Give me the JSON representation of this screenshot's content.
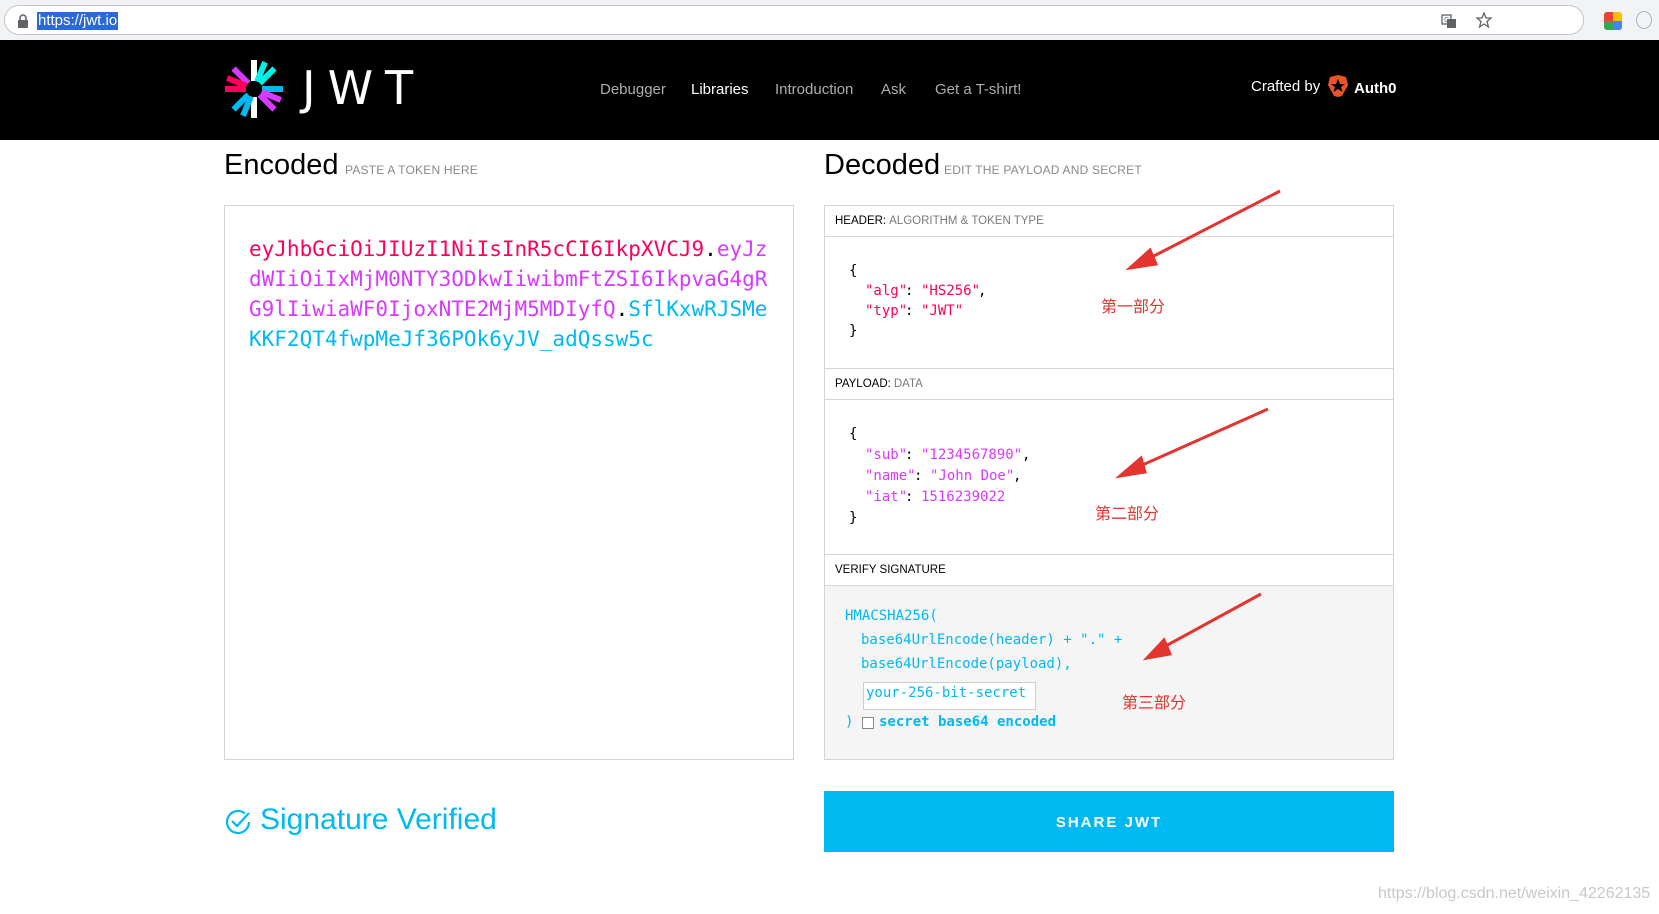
{
  "browser": {
    "url": "https://jwt.io"
  },
  "navbar": {
    "logo_text": "JWT",
    "items": [
      {
        "label": "Debugger",
        "active": false
      },
      {
        "label": "Libraries",
        "active": true
      },
      {
        "label": "Introduction",
        "active": false
      },
      {
        "label": "Ask",
        "active": false
      },
      {
        "label": "Get a T-shirt!",
        "active": false
      }
    ],
    "crafted_by": "Crafted by",
    "brand": "Auth0"
  },
  "encoded": {
    "title": "Encoded",
    "subtitle": "PASTE A TOKEN HERE",
    "token_header": "eyJhbGciOiJIUzI1NiIsInR5cCI6IkpXVCJ9",
    "dot1": ".",
    "token_payload": "eyJzdWIiOiIxMjM0NTY3ODkwIiwibmFtZSI6IkpvaG4gRG9lIiwiaWF0IjoxNTE2MjM5MDIyfQ",
    "dot2": ".",
    "token_signature": "SflKxwRJSMeKKF2QT4fwpMeJf36POk6yJV_adQssw5c",
    "colors": {
      "header": "#fb015b",
      "payload": "#d63aff",
      "signature": "#00b9f1"
    }
  },
  "decoded": {
    "title": "Decoded",
    "subtitle": "EDIT THE PAYLOAD AND SECRET",
    "header_section": {
      "label": "HEADER:",
      "sublabel": "ALGORITHM & TOKEN TYPE",
      "open": "{",
      "alg_key": "\"alg\"",
      "alg_value": "\"HS256\"",
      "typ_key": "\"typ\"",
      "typ_value": "\"JWT\"",
      "close": "}"
    },
    "payload_section": {
      "label": "PAYLOAD:",
      "sublabel": "DATA",
      "open": "{",
      "sub_key": "\"sub\"",
      "sub_value": "\"1234567890\"",
      "name_key": "\"name\"",
      "name_value": "\"John Doe\"",
      "iat_key": "\"iat\"",
      "iat_value": "1516239022",
      "close": "}"
    },
    "verify_section": {
      "label": "VERIFY SIGNATURE",
      "line1": "HMACSHA256(",
      "line2": "base64UrlEncode(header) + \".\" +",
      "line3": "base64UrlEncode(payload),",
      "secret_value": "your-256-bit-secret",
      "close": ")",
      "checkbox_label": "secret base64 encoded",
      "checkbox_checked": false
    }
  },
  "annotations": {
    "part1": "第一部分",
    "part2": "第二部分",
    "part3": "第三部分",
    "color": "#e3342f"
  },
  "footer": {
    "verified_text": "Signature Verified",
    "share_button": "SHARE JWT",
    "watermark": "https://blog.csdn.net/weixin_42262135"
  }
}
